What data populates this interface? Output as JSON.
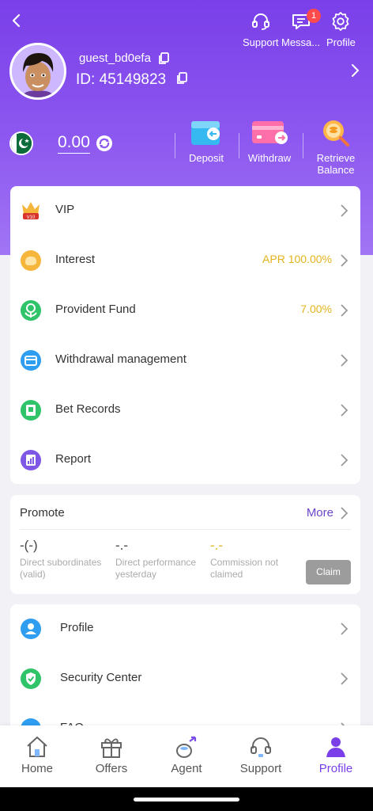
{
  "colors": {
    "brand": "#7a3fe9",
    "gold": "#e3b31c",
    "claim_bg": "#9c9c9c"
  },
  "topbar": {
    "support_label": "Support",
    "messages_label": "Messa...",
    "messages_badge": "1",
    "profile_label": "Profile"
  },
  "user": {
    "name": "guest_bd0efa",
    "id": "ID: 45149823"
  },
  "wallet": {
    "balance": "0.00",
    "country": "Pakistan"
  },
  "actions": {
    "deposit": "Deposit",
    "withdraw": "Withdraw",
    "retrieve": [
      "Retrieve",
      "Balance"
    ]
  },
  "menu": [
    {
      "label": "VIP",
      "value": "",
      "icon": "vip-crown-icon"
    },
    {
      "label": "Interest",
      "value": "APR 100.00%",
      "icon": "interest-icon"
    },
    {
      "label": "Provident Fund",
      "value": "7.00%",
      "icon": "provident-fund-icon"
    },
    {
      "label": "Withdrawal management",
      "value": "",
      "icon": "wallet-icon"
    },
    {
      "label": "Bet Records",
      "value": "",
      "icon": "bet-records-icon"
    },
    {
      "label": "Report",
      "value": "",
      "icon": "report-icon"
    }
  ],
  "promote": {
    "title": "Promote",
    "more": "More",
    "stats": [
      {
        "value": "-(-)",
        "caption": [
          "Direct subordinates",
          "(valid)"
        ]
      },
      {
        "value": "-.-",
        "caption": [
          "Direct performance",
          "yesterday"
        ]
      },
      {
        "value": "-.-",
        "caption": [
          "Commission not",
          "claimed"
        ]
      }
    ],
    "claim": "Claim"
  },
  "settings": [
    {
      "label": "Profile",
      "icon": "profile-icon"
    },
    {
      "label": "Security Center",
      "icon": "shield-icon"
    },
    {
      "label": "FAQ",
      "icon": "faq-icon"
    }
  ],
  "nav": [
    {
      "label": "Home",
      "icon": "home-icon"
    },
    {
      "label": "Offers",
      "icon": "gift-icon"
    },
    {
      "label": "Agent",
      "icon": "agent-icon"
    },
    {
      "label": "Support",
      "icon": "headset-icon"
    },
    {
      "label": "Profile",
      "icon": "person-icon",
      "active": true
    }
  ]
}
